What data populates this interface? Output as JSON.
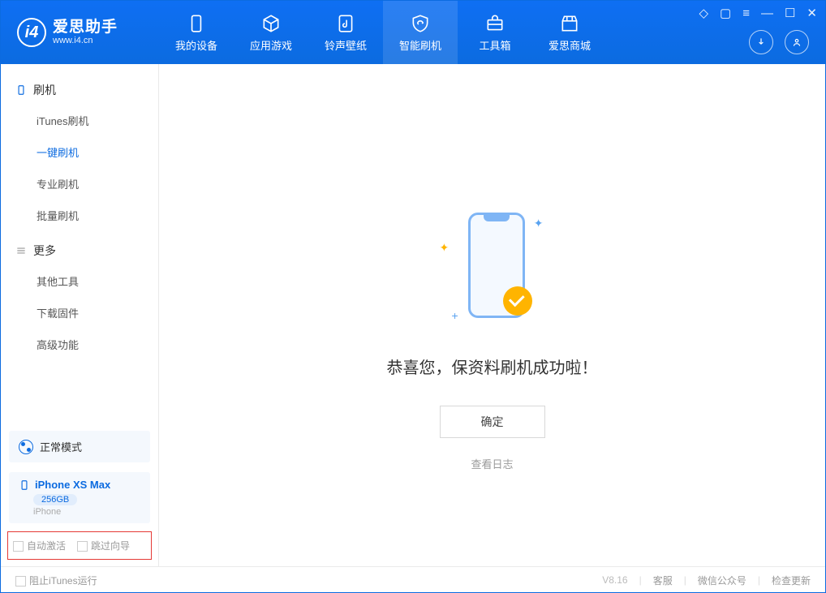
{
  "app": {
    "title": "爱思助手",
    "subtitle": "www.i4.cn"
  },
  "nav": {
    "tabs": [
      {
        "label": "我的设备"
      },
      {
        "label": "应用游戏"
      },
      {
        "label": "铃声壁纸"
      },
      {
        "label": "智能刷机"
      },
      {
        "label": "工具箱"
      },
      {
        "label": "爱思商城"
      }
    ]
  },
  "sidebar": {
    "group1": {
      "title": "刷机",
      "items": [
        {
          "label": "iTunes刷机"
        },
        {
          "label": "一键刷机"
        },
        {
          "label": "专业刷机"
        },
        {
          "label": "批量刷机"
        }
      ]
    },
    "group2": {
      "title": "更多",
      "items": [
        {
          "label": "其他工具"
        },
        {
          "label": "下载固件"
        },
        {
          "label": "高级功能"
        }
      ]
    },
    "mode": {
      "label": "正常模式"
    },
    "device": {
      "name": "iPhone XS Max",
      "storage": "256GB",
      "type": "iPhone"
    },
    "checkboxes": {
      "auto_activate": "自动激活",
      "skip_guide": "跳过向导"
    }
  },
  "main": {
    "success_text": "恭喜您，保资料刷机成功啦！",
    "ok_button": "确定",
    "log_link": "查看日志"
  },
  "footer": {
    "block_itunes": "阻止iTunes运行",
    "version": "V8.16",
    "links": {
      "service": "客服",
      "wechat": "微信公众号",
      "update": "检查更新"
    }
  }
}
